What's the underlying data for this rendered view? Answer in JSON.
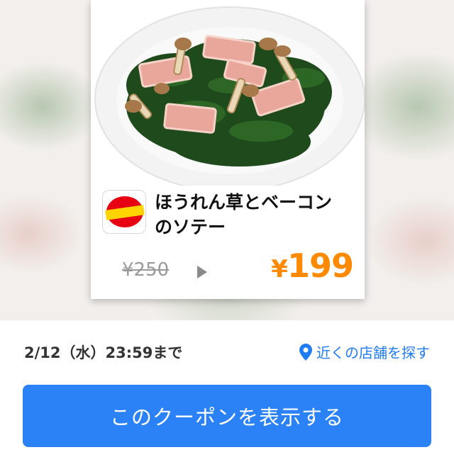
{
  "coupon": {
    "title_line1": "ほうれん草とベーコン",
    "title_line2": "のソテー",
    "old_price": "¥250",
    "new_price_symbol": "¥",
    "new_price_value": "199",
    "brand_logo": "jonathan-logo"
  },
  "footer": {
    "expiry": "2/12（水）23:59まで",
    "store_link": "近くの店舗を探す",
    "store_icon": "location-pin-icon"
  },
  "cta": {
    "label": "このクーポンを表示する"
  },
  "colors": {
    "accent_blue": "#2b82f6",
    "link_blue": "#1f7cf5",
    "price_orange": "#ff8a00",
    "old_price_gray": "#9a9a9a"
  }
}
